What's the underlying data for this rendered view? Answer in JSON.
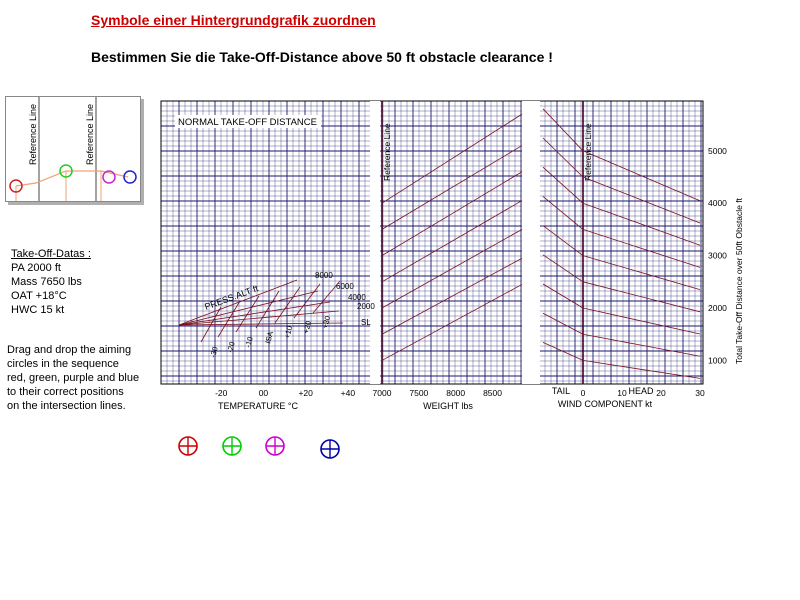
{
  "page": {
    "title": "Symbole einer Hintergrundgrafik zuordnen",
    "subtitle": "Bestimmen Sie die Take-Off-Distance above 50 ft obstacle clearance !"
  },
  "example": {
    "reference_label": "Reference Line",
    "circle_colors": [
      "#cc2222",
      "#22cc22",
      "#cc22cc",
      "#2222cc"
    ]
  },
  "datas": {
    "heading": "Take-Off-Datas :",
    "lines": [
      "PA 2000 ft",
      "Mass 7650 lbs",
      "OAT  +18°C",
      "HWC   15 kt"
    ]
  },
  "instructions": [
    "Drag and drop the aiming",
    "circles in the sequence",
    "red, green, purple and blue",
    "to their correct  positions",
    "on the  intersection lines."
  ],
  "aiming_circles": [
    {
      "name": "red",
      "color": "#cc0000"
    },
    {
      "name": "green",
      "color": "#00cc00"
    },
    {
      "name": "purple",
      "color": "#cc00cc"
    },
    {
      "name": "blue",
      "color": "#0000aa"
    }
  ],
  "chart_data": {
    "type": "line",
    "title": "NORMAL TAKE-OFF DISTANCE",
    "reference_line_label": "Reference Line",
    "grid": true,
    "colors": {
      "grid": "#1a1a6e",
      "lines": "#7a1020"
    },
    "temperature": {
      "xlabel": "TEMPERATURE °C",
      "ticks": [
        "-20",
        "00",
        "+20",
        "+40"
      ],
      "tick_values": [
        -20,
        0,
        20,
        40
      ],
      "xlim": [
        -40,
        50
      ],
      "pressure_alt_label": "PRESS.ALT  ft",
      "pressure_alt_values": [
        "8000",
        "6000",
        "4000",
        "2000",
        "SL"
      ],
      "isa_labels": [
        "-30",
        "-20",
        "-10",
        "ISA",
        "+10",
        "+20",
        "+30"
      ]
    },
    "weight": {
      "xlabel": "WEIGHT lbs",
      "ticks": [
        "7000",
        "7500",
        "8000",
        "8500"
      ],
      "tick_values": [
        7000,
        7500,
        8000,
        8500
      ],
      "xlim": [
        7000,
        8900
      ],
      "ref_distances": [
        1000,
        1500,
        2000,
        2500,
        3000
      ],
      "heavy_distances": [
        2450,
        2950,
        3500,
        4050,
        4600,
        5100,
        5700
      ]
    },
    "wind": {
      "xlabel": "WIND COMPONENT kt",
      "tail_label": "TAIL",
      "head_label": "HEAD",
      "ticks": [
        "0",
        "10",
        "20",
        "30"
      ],
      "tick_values": [
        0,
        10,
        20,
        30
      ],
      "xlim": [
        -10,
        30
      ],
      "ref_distances": [
        1000,
        1500,
        2000,
        2500,
        3000,
        3500,
        4000,
        4500,
        5000
      ]
    },
    "ylabel": "Total Take-Off Distance over 50ft Obstacle  ft",
    "yticks": [
      "1000",
      "2000",
      "3000",
      "4000",
      "5000"
    ],
    "ytick_values": [
      1000,
      2000,
      3000,
      4000,
      5000
    ],
    "ylim": [
      550,
      5950
    ]
  }
}
